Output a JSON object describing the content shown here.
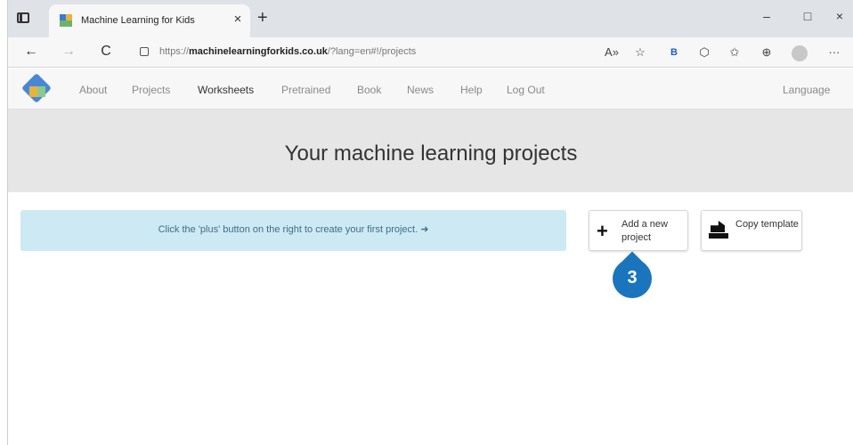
{
  "browser": {
    "tab_title": "Machine Learning for Kids",
    "tab_close": "×",
    "new_tab": "+",
    "window_controls": {
      "minimize": "–",
      "maximize": "□",
      "close": "×"
    },
    "url_prefix": "https://",
    "url_domain": "machinelearningforkids.co.uk",
    "url_path": "/?lang=en#!/projects",
    "toolbar_icons": [
      "read-aloud-icon",
      "favorites-add-icon",
      "bing-icon",
      "extensions-icon",
      "favorites-icon",
      "collections-icon",
      "profile-icon",
      "more-icon"
    ],
    "toolbar_glyphs": {
      "read_aloud": "A»",
      "fav_add": "☆",
      "bing": "B",
      "ext": "⬡",
      "fav": "✩",
      "coll": "⊕",
      "more": "···"
    },
    "nav_glyphs": {
      "back": "←",
      "forward": "→",
      "reload": "C"
    }
  },
  "site": {
    "nav": [
      "About",
      "Projects",
      "Worksheets",
      "Pretrained",
      "Book",
      "News",
      "Help",
      "Log Out"
    ],
    "active_nav": "Worksheets",
    "language": "Language",
    "page_title": "Your machine learning projects",
    "info_text": "Click the 'plus' button on the right to create your first project. ➜",
    "add_button": {
      "icon": "+",
      "label": "Add a new project"
    },
    "copy_button": {
      "label": "Copy template"
    },
    "callout_number": "3"
  },
  "colors": {
    "hero_bg": "#e6e6e6",
    "info_bg": "#cde9f4",
    "callout": "#1b75bc"
  }
}
